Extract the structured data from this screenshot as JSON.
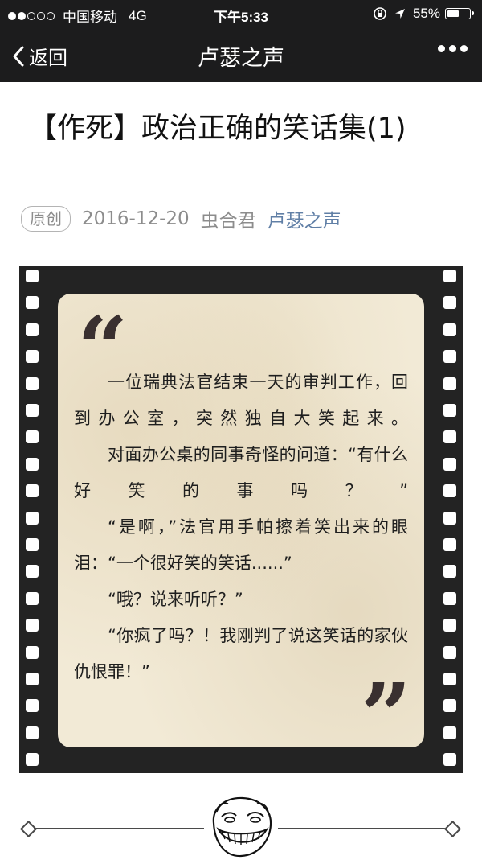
{
  "status_bar": {
    "carrier": "中国移动",
    "network": "4G",
    "time": "下午5:33",
    "battery": "55%",
    "battery_level": 0.55,
    "signal_bars": 2
  },
  "nav": {
    "back_label": "返回",
    "title": "卢瑟之声",
    "more_icon": "more-dots-icon"
  },
  "article": {
    "title": "【作死】政治正确的笑话集(1)",
    "tag": "原创",
    "date": "2016-12-20",
    "author": "虫合君",
    "account": "卢瑟之声"
  },
  "quote_card": {
    "open_quote": "“",
    "close_quote": "”",
    "paragraphs": [
      "一位瑞典法官结束一天的审判工作，回到办公室，突然独自大笑起来。",
      "对面办公桌的同事奇怪的问道：“有什么好笑的事吗？”",
      "“是啊，”法官用手帕擦着笑出来的眼泪：“一个很好笑的笑话......”",
      "“哦？说来听听？”",
      "“你疯了吗？！我刚判了说这笑话的家伙仇恨罪！”"
    ]
  },
  "colors": {
    "bar_bg": "#1c1c1d",
    "link": "#607fa6",
    "film": "#232323",
    "paper": "#f2ead6"
  }
}
